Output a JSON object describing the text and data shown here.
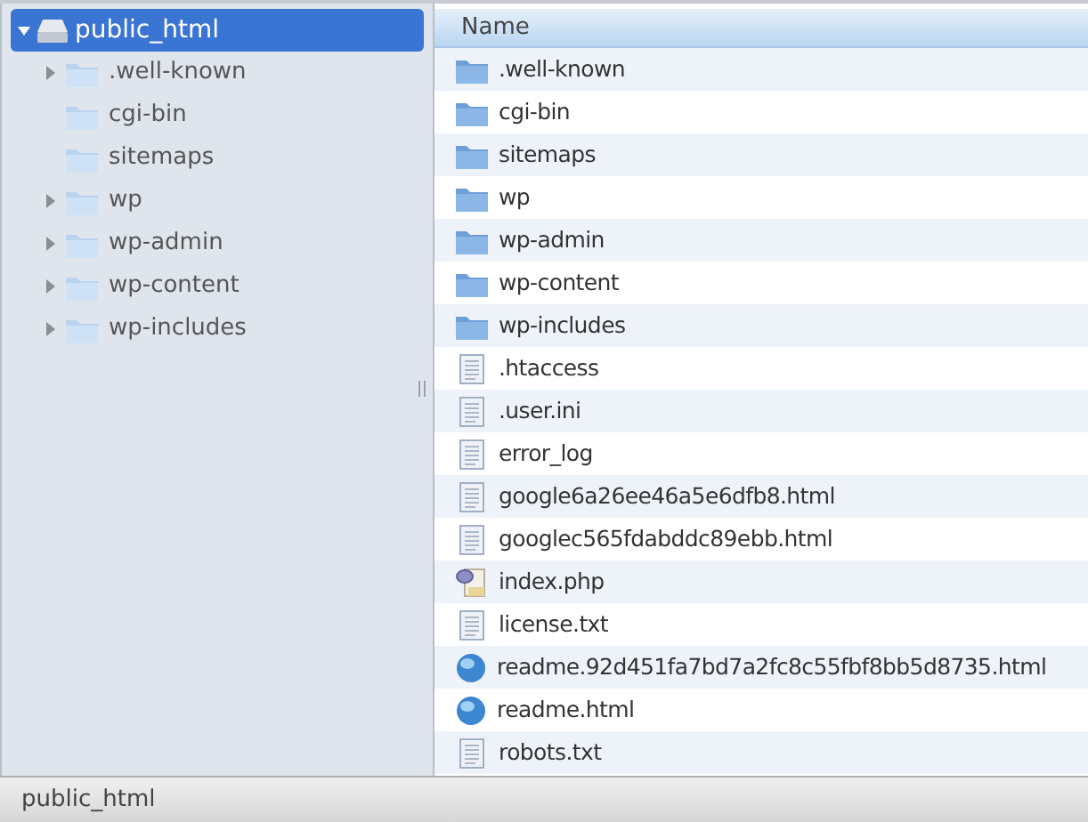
{
  "tree": {
    "label": "public_html",
    "expanded": true,
    "selected": true,
    "children": [
      {
        "label": ".well-known",
        "expandable": true,
        "selected": false
      },
      {
        "label": "cgi-bin",
        "expandable": false,
        "selected": false
      },
      {
        "label": "sitemaps",
        "expandable": false,
        "selected": false
      },
      {
        "label": "wp",
        "expandable": true,
        "selected": false
      },
      {
        "label": "wp-admin",
        "expandable": true,
        "selected": false
      },
      {
        "label": "wp-content",
        "expandable": true,
        "selected": false
      },
      {
        "label": "wp-includes",
        "expandable": true,
        "selected": false
      }
    ]
  },
  "list": {
    "columns": [
      "Name"
    ],
    "rows": [
      {
        "name": ".well-known",
        "kind": "folder"
      },
      {
        "name": "cgi-bin",
        "kind": "folder"
      },
      {
        "name": "sitemaps",
        "kind": "folder"
      },
      {
        "name": "wp",
        "kind": "folder"
      },
      {
        "name": "wp-admin",
        "kind": "folder"
      },
      {
        "name": "wp-content",
        "kind": "folder"
      },
      {
        "name": "wp-includes",
        "kind": "folder"
      },
      {
        "name": ".htaccess",
        "kind": "file"
      },
      {
        "name": ".user.ini",
        "kind": "file"
      },
      {
        "name": "error_log",
        "kind": "file"
      },
      {
        "name": "google6a26ee46a5e6dfb8.html",
        "kind": "file"
      },
      {
        "name": "googlec565fdabddc89ebb.html",
        "kind": "file"
      },
      {
        "name": "index.php",
        "kind": "php"
      },
      {
        "name": "license.txt",
        "kind": "file"
      },
      {
        "name": "readme.92d451fa7bd7a2fc8c55fbf8bb5d8735.html",
        "kind": "web"
      },
      {
        "name": "readme.html",
        "kind": "web"
      },
      {
        "name": "robots.txt",
        "kind": "file"
      }
    ]
  },
  "status_bar": "public_html"
}
